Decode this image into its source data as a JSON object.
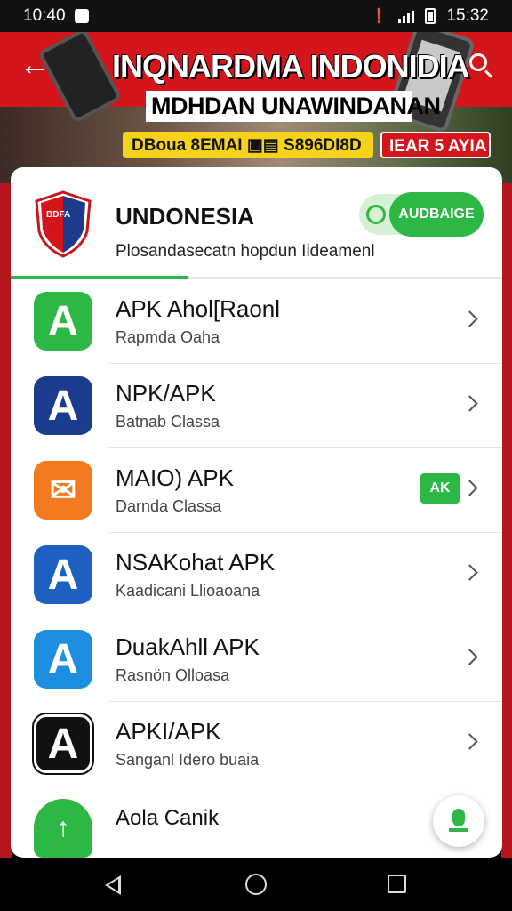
{
  "status_bar": {
    "time_left": "10:40",
    "time_right": "15:32",
    "icons": [
      "notification-icon",
      "vibrate-icon",
      "signal-icon",
      "battery-icon"
    ]
  },
  "banner": {
    "title": "INQNARDMA INDONIDIA",
    "subtitle": "MDHDAN UNAWINDANAN",
    "tag_yellow": "DBoua 8EMAI  ▣▤  S896DI8D",
    "tag_red": "IEAR 5 AYIA",
    "icons": [
      "back-arrow-icon",
      "search-icon"
    ]
  },
  "card": {
    "title": "UNDONESIA",
    "description": "Plosandasecatn hopdun Iideamenl",
    "update_label": "AUDBAIGE",
    "progress": 0.36,
    "accent": "#2db845"
  },
  "apps": [
    {
      "name": "APK Ahol[Raonl",
      "sub": "Rapmda Oaha",
      "icon": "a-letter-icon",
      "icon_color": "#2db845",
      "badge": ""
    },
    {
      "name": "NPK/APK",
      "sub": "Batnab Classa",
      "icon": "a-letter-icon",
      "icon_color": "#1b3c8c",
      "badge": ""
    },
    {
      "name": "MAIO) APK",
      "sub": "Darnda Classa",
      "icon": "envelope-icon",
      "icon_color": "#f47a20",
      "badge": "AK"
    },
    {
      "name": "NSAKohat APK",
      "sub": "Kaadicani Llioaoana",
      "icon": "a-letter-icon",
      "icon_color": "#1e5fc2",
      "badge": ""
    },
    {
      "name": "DuakAhll APK",
      "sub": "Rasnön Olloasa",
      "icon": "a-letter-icon",
      "icon_color": "#1e8fe0",
      "badge": ""
    },
    {
      "name": "APKI/APK",
      "sub": "Sanganl Idero buaia",
      "icon": "a-letter-icon",
      "icon_color": "#111111",
      "badge": ""
    },
    {
      "name": "Aola Canik",
      "sub": "",
      "icon": "a-letter-icon",
      "icon_color": "#2db845",
      "badge": ""
    }
  ],
  "nav": {
    "icons": [
      "back-icon",
      "home-icon",
      "recents-icon"
    ]
  }
}
